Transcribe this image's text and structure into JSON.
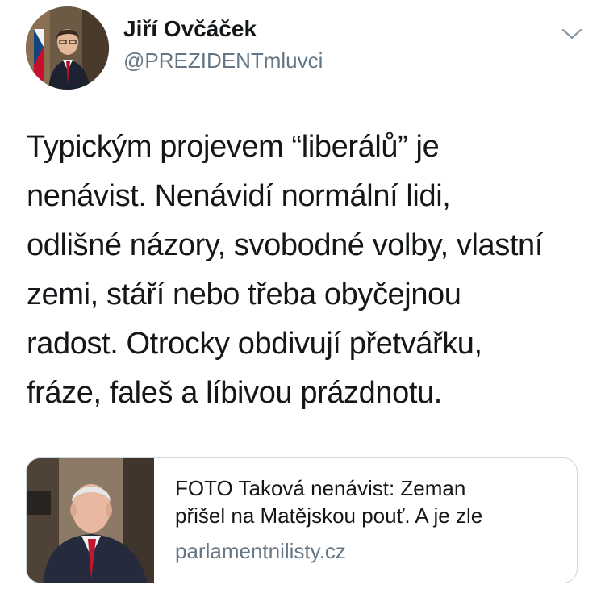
{
  "author": {
    "name": "Jiří Ovčáček",
    "handle": "@PREZIDENTmluvci",
    "avatar_icon": "profile-photo"
  },
  "menu": {
    "icon": "chevron-down-icon"
  },
  "tweet": {
    "lines": [
      "Typickým projevem “liberálů” je",
      "nenávist. Nenávidí normální lidi,",
      "odlišné názory, svobodné volby, vlastní",
      "zemi, stáří nebo třeba obyčejnou",
      "radost. Otrocky obdivují přetvářku,",
      "fráze, faleš a líbivou prázdnotu."
    ]
  },
  "link_card": {
    "title_lines": [
      "FOTO Taková nenávist: Zeman",
      "přišel na Matějskou pouť. A je zle"
    ],
    "domain": "parlamentnilisty.cz",
    "thumbnail_icon": "article-photo"
  },
  "colors": {
    "text_primary": "#14171a",
    "text_secondary": "#657786",
    "border": "#ccd6dd",
    "chevron": "#8899a6"
  }
}
